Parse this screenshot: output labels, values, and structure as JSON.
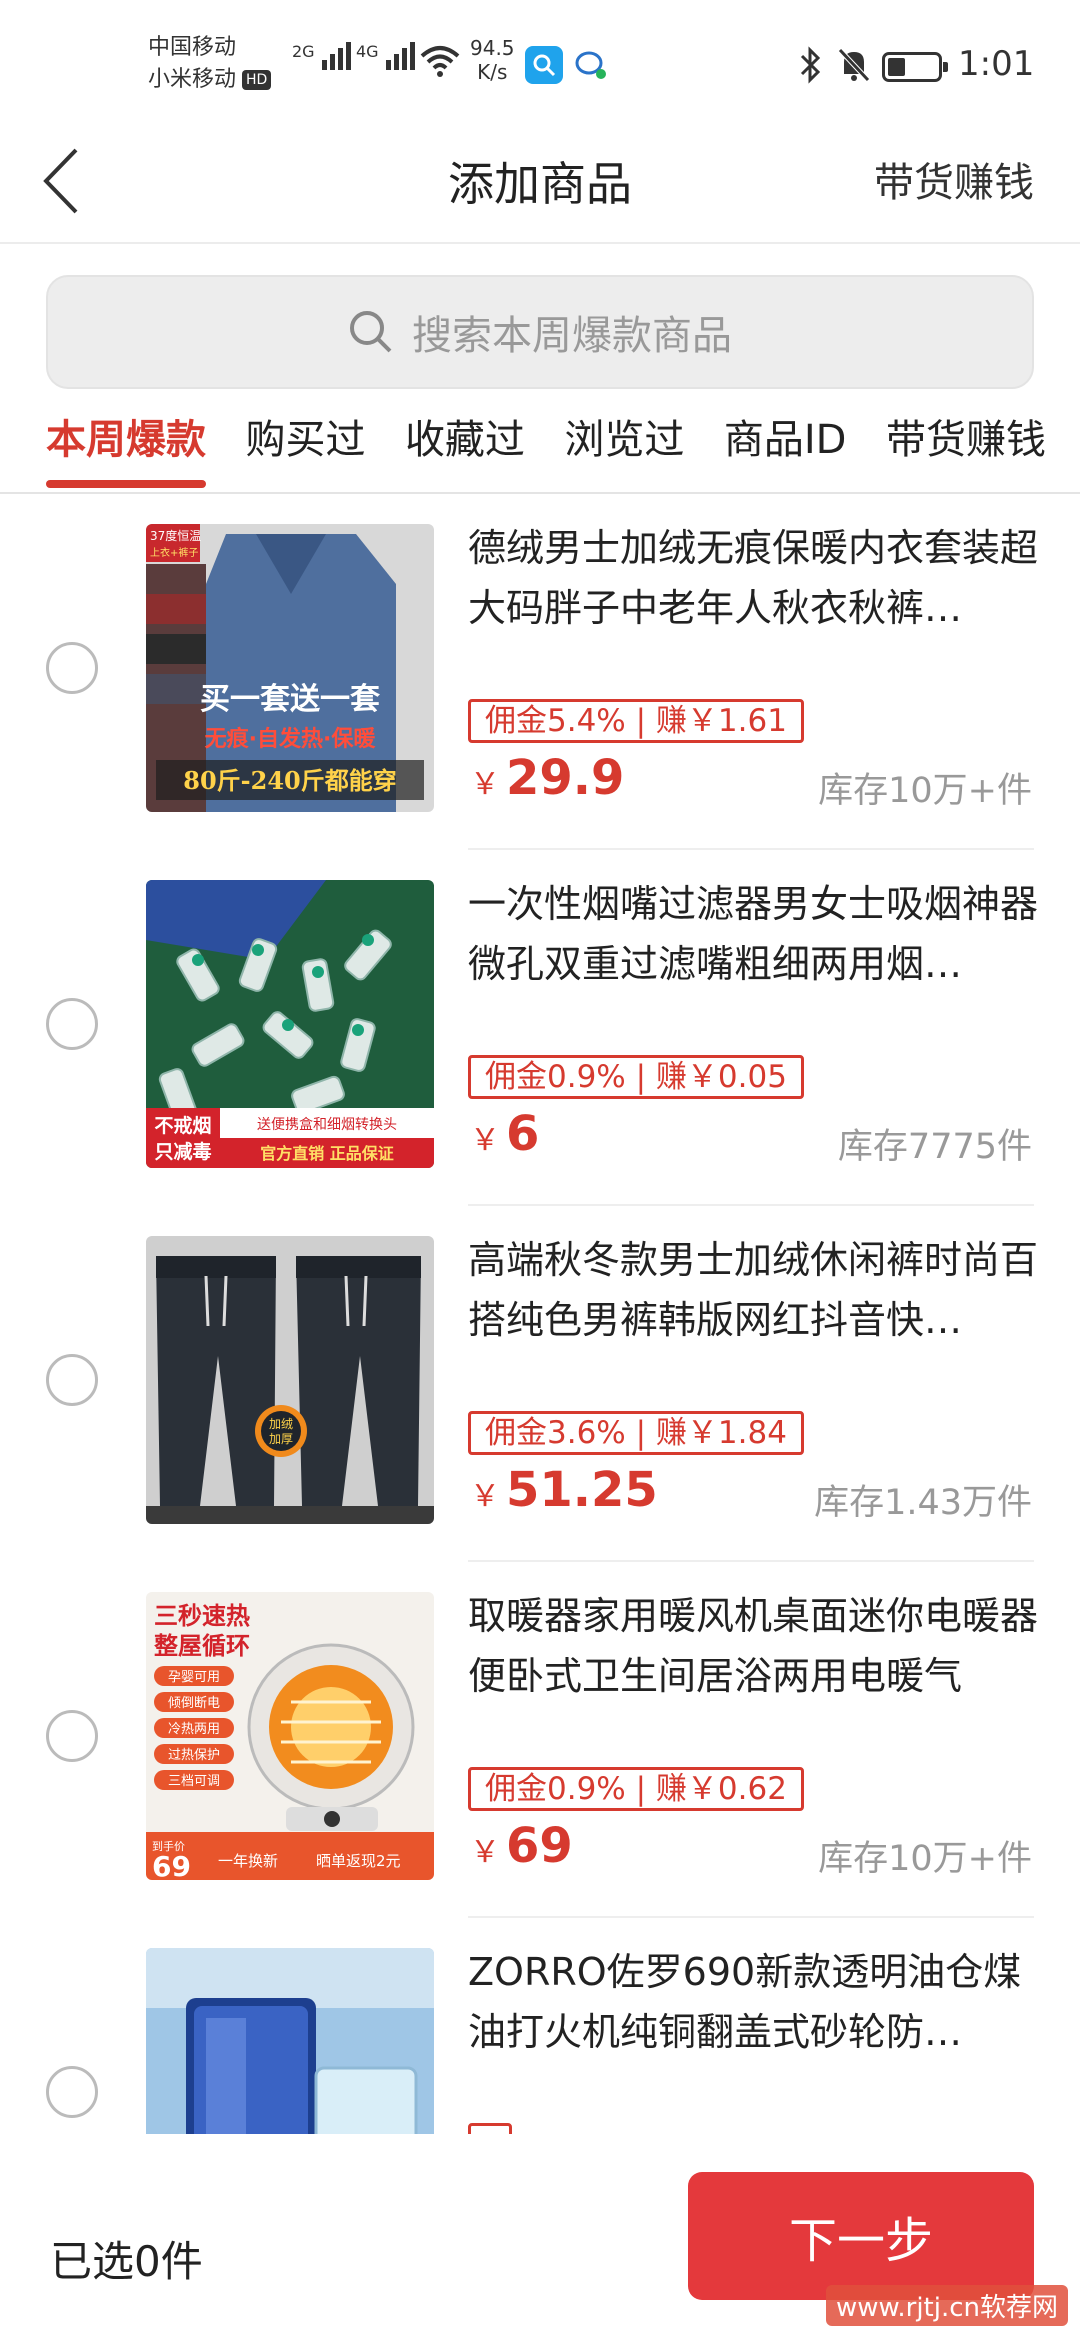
{
  "status_bar": {
    "carrier_1": "中国移动",
    "carrier_2": "小米移动",
    "hd_badge": "HD",
    "signal_1_label": "2G",
    "signal_2_label": "4G",
    "net_speed_value": "94.5",
    "net_speed_unit": "K/s",
    "time": "1:01",
    "battery_level": 0.35
  },
  "header": {
    "back_icon": "chevron-left-icon",
    "title": "添加商品",
    "action": "带货赚钱"
  },
  "search": {
    "placeholder": "搜索本周爆款商品"
  },
  "tabs": [
    {
      "label": "本周爆款",
      "active": true
    },
    {
      "label": "购买过",
      "active": false
    },
    {
      "label": "收藏过",
      "active": false
    },
    {
      "label": "浏览过",
      "active": false
    },
    {
      "label": "商品ID",
      "active": false
    },
    {
      "label": "带货赚钱",
      "active": false
    }
  ],
  "products": [
    {
      "title": "德绒男士加绒无痕保暖内衣套装超大码胖子中老年人秋衣秋裤…",
      "commission": "佣金5.4% | 赚￥1.61",
      "currency": "￥",
      "price": "29.9",
      "stock": "库存10万+件",
      "image_texts": [
        "37度恒温",
        "上衣+裤子",
        "买一套送一套",
        "无痕·自发热·保暖",
        "80斤-240斤都能穿"
      ]
    },
    {
      "title": "一次性烟嘴过滤器男女士吸烟神器微孔双重过滤嘴粗细两用烟…",
      "commission": "佣金0.9% | 赚￥0.05",
      "currency": "￥",
      "price": "6",
      "stock": "库存7775件",
      "image_texts": [
        "不戒烟",
        "只减毒",
        "送便携盒和细烟转换头",
        "官方直销 正品保证"
      ]
    },
    {
      "title": "高端秋冬款男士加绒休闲裤时尚百搭纯色男裤韩版网红抖音快…",
      "commission": "佣金3.6% | 赚￥1.84",
      "currency": "￥",
      "price": "51.25",
      "stock": "库存1.43万件",
      "image_texts": [
        "加绒",
        "加厚"
      ]
    },
    {
      "title": "取暖器家用暖风机桌面迷你电暖器便卧式卫生间居浴两用电暖气",
      "commission": "佣金0.9% | 赚￥0.62",
      "currency": "￥",
      "price": "69",
      "stock": "库存10万+件",
      "image_texts": [
        "三秒速热",
        "整屋循环",
        "孕婴可用",
        "倾倒断电",
        "冷热两用",
        "过热保护",
        "三档可调",
        "到手价",
        "69",
        "一年换新",
        "晒单返现2元"
      ]
    },
    {
      "title": "ZORRO佐罗690新款透明油仓煤油打火机纯铜翻盖式砂轮防…",
      "commission": "",
      "currency": "",
      "price": "",
      "stock": "",
      "image_texts": []
    }
  ],
  "bottom_bar": {
    "selected": "已选0件",
    "next_button": "下一步",
    "watermark": "www.rjtj.cn软荐网"
  },
  "colors": {
    "accent": "#d63a2f",
    "button": "#e4393c",
    "muted": "#999999"
  }
}
